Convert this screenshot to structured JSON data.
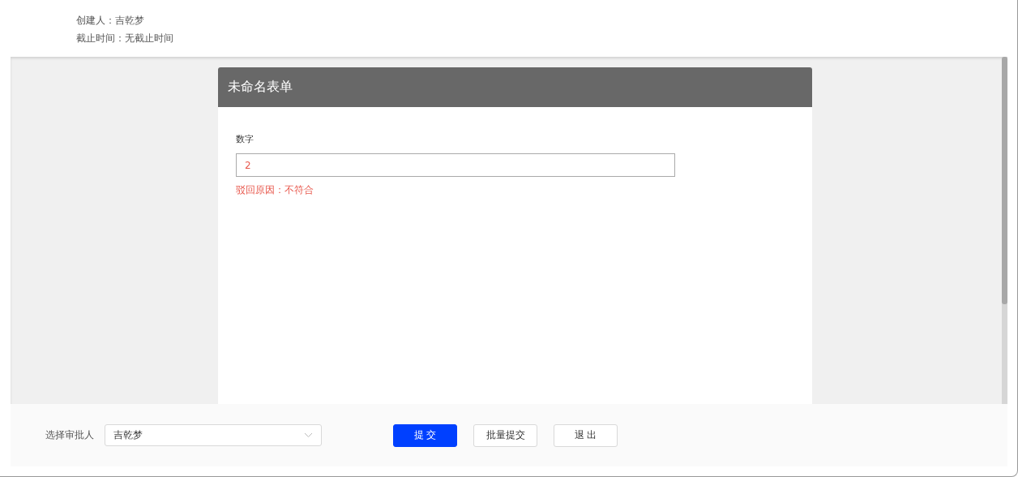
{
  "info": [
    "创建人：吉乾梦",
    "截止时间：无截止时间"
  ],
  "form": {
    "title": "未命名表单",
    "fields": [
      {
        "label": "数字",
        "value": "2",
        "rejected": true,
        "reject_reason": "驳回原因：不符合"
      }
    ]
  },
  "footer": {
    "approver_label": "选择审批人",
    "approver": "吉乾梦",
    "buttons": [
      {
        "label": "提 交",
        "kind": "primary"
      },
      {
        "label": "批量提交",
        "kind": "default"
      },
      {
        "label": "退 出",
        "kind": "default"
      }
    ]
  }
}
